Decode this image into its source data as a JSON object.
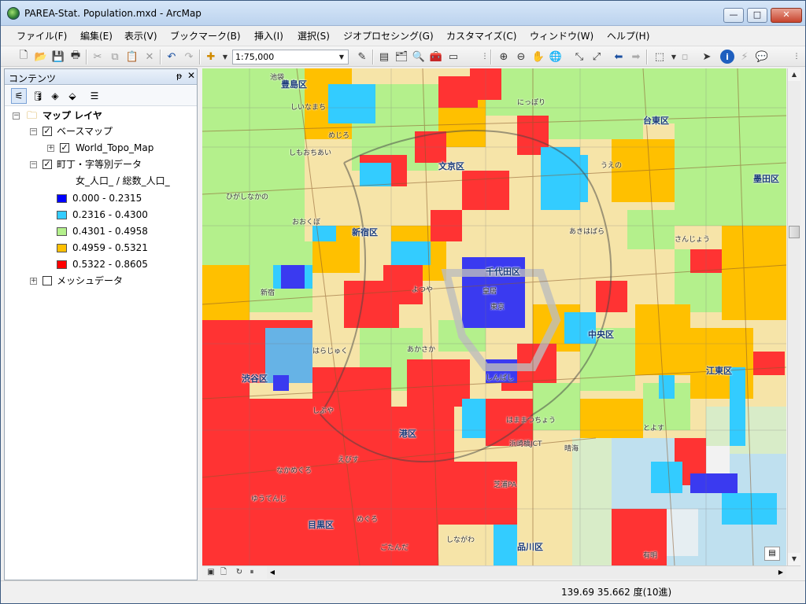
{
  "window": {
    "title": "PAREA-Stat. Population.mxd - ArcMap",
    "controls": {
      "minimize": "—",
      "maximize": "□",
      "close": "✕"
    }
  },
  "menu": [
    "ファイル(F)",
    "編集(E)",
    "表示(V)",
    "ブックマーク(B)",
    "挿入(I)",
    "選択(S)",
    "ジオプロセシング(G)",
    "カスタマイズ(C)",
    "ウィンドウ(W)",
    "ヘルプ(H)"
  ],
  "toolbar": {
    "scale": "1:75,000"
  },
  "toc": {
    "title": "コンテンツ",
    "pin": "ᵽ",
    "close": "✕",
    "root": "マップ レイヤ",
    "groups": [
      {
        "label": "ベースマップ",
        "checked": true,
        "children": [
          "World_Topo_Map"
        ]
      },
      {
        "label": "町丁・字等別データ",
        "checked": true,
        "field": "女_人口_ / 総数_人口_",
        "classes": [
          {
            "label": "0.000 - 0.2315",
            "color": "#0000ff"
          },
          {
            "label": "0.2316 - 0.4300",
            "color": "#33ccff"
          },
          {
            "label": "0.4301 - 0.4958",
            "color": "#b4f08c"
          },
          {
            "label": "0.4959 - 0.5321",
            "color": "#ffc000"
          },
          {
            "label": "0.5322 - 0.8605",
            "color": "#ff0000"
          }
        ]
      },
      {
        "label": "メッシュデータ",
        "checked": false
      }
    ]
  },
  "map": {
    "labels": [
      {
        "text": "文京区",
        "big": true
      },
      {
        "text": "新宿区",
        "big": true
      },
      {
        "text": "台東区",
        "big": true
      },
      {
        "text": "墨田区",
        "big": true
      },
      {
        "text": "千代田区",
        "big": true
      },
      {
        "text": "中央区",
        "big": true
      },
      {
        "text": "港区",
        "big": true
      },
      {
        "text": "渋谷区",
        "big": true
      },
      {
        "text": "江東区",
        "big": true
      },
      {
        "text": "目黒区",
        "big": true
      },
      {
        "text": "豊島区",
        "big": true
      },
      {
        "text": "品川区",
        "big": true
      },
      {
        "text": "しいなまち",
        "big": false
      },
      {
        "text": "めじろ",
        "big": false
      },
      {
        "text": "しもおちあい",
        "big": false
      },
      {
        "text": "ひがしなかの",
        "big": false
      },
      {
        "text": "おおくぼ",
        "big": false
      },
      {
        "text": "よつや",
        "big": false
      },
      {
        "text": "あかさか",
        "big": false
      },
      {
        "text": "はらじゅく",
        "big": false
      },
      {
        "text": "しぶや",
        "big": false
      },
      {
        "text": "えびす",
        "big": false
      },
      {
        "text": "なかめぐろ",
        "big": false
      },
      {
        "text": "ゆうてんじ",
        "big": false
      },
      {
        "text": "めぐろ",
        "big": false
      },
      {
        "text": "ごたんだ",
        "big": false
      },
      {
        "text": "にっぽり",
        "big": false
      },
      {
        "text": "うえの",
        "big": false
      },
      {
        "text": "あきはばら",
        "big": false
      },
      {
        "text": "さんじょう",
        "big": false
      },
      {
        "text": "しんばし",
        "big": false
      },
      {
        "text": "はままつちょう",
        "big": false
      },
      {
        "text": "とよす",
        "big": false
      },
      {
        "text": "しながわ",
        "big": false
      },
      {
        "text": "有明",
        "big": false
      },
      {
        "text": "晴海",
        "big": false
      },
      {
        "text": "東京",
        "big": false
      },
      {
        "text": "皇居",
        "big": false
      },
      {
        "text": "新宿",
        "big": false
      },
      {
        "text": "池袋",
        "big": false
      },
      {
        "text": "芝浦PA",
        "big": false
      },
      {
        "text": "浜崎橋JCT",
        "big": false
      }
    ]
  },
  "status": {
    "coords": "139.69  35.662 度(10進)"
  }
}
